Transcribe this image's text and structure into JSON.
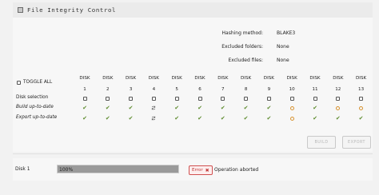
{
  "window": {
    "title": "File Integrity Control",
    "icon": "drive-icon"
  },
  "settings": [
    {
      "label": "Hashing method:",
      "value": "BLAKE3"
    },
    {
      "label": "Excluded folders:",
      "value": "None"
    },
    {
      "label": "Excluded files:",
      "value": "None"
    }
  ],
  "toggle_all_label": "TOGGLE ALL",
  "disk_label": "DISK",
  "disks": [
    "1",
    "2",
    "3",
    "4",
    "5",
    "6",
    "7",
    "8",
    "9",
    "10",
    "11",
    "12",
    "13"
  ],
  "rows": [
    {
      "label": "Disk selection",
      "italic": false,
      "cells": [
        "checkbox",
        "checkbox",
        "checkbox",
        "checkbox",
        "checkbox",
        "checkbox",
        "checkbox",
        "checkbox",
        "checkbox",
        "checkbox",
        "checkbox",
        "checkbox",
        "checkbox"
      ]
    },
    {
      "label": "Build up-to-date",
      "italic": true,
      "cells": [
        "check",
        "check",
        "check",
        "sync",
        "check",
        "check",
        "check",
        "check",
        "check",
        "circle",
        "check",
        "circle",
        "circle"
      ]
    },
    {
      "label": "Export up-to-date",
      "italic": true,
      "cells": [
        "check",
        "check",
        "check",
        "sync",
        "check",
        "check",
        "check",
        "check",
        "check",
        "circle",
        "check",
        "check",
        "check"
      ]
    }
  ],
  "buttons": {
    "build": "BUILD",
    "export": "EXPORT"
  },
  "status": {
    "disk": "Disk 1",
    "progress_percent": 100,
    "progress_text": "100%",
    "badge": "Error",
    "message": "Operation aborted"
  },
  "colors": {
    "check": "#5e8c2f",
    "pending": "#d7922f",
    "error": "#c23a3a"
  }
}
